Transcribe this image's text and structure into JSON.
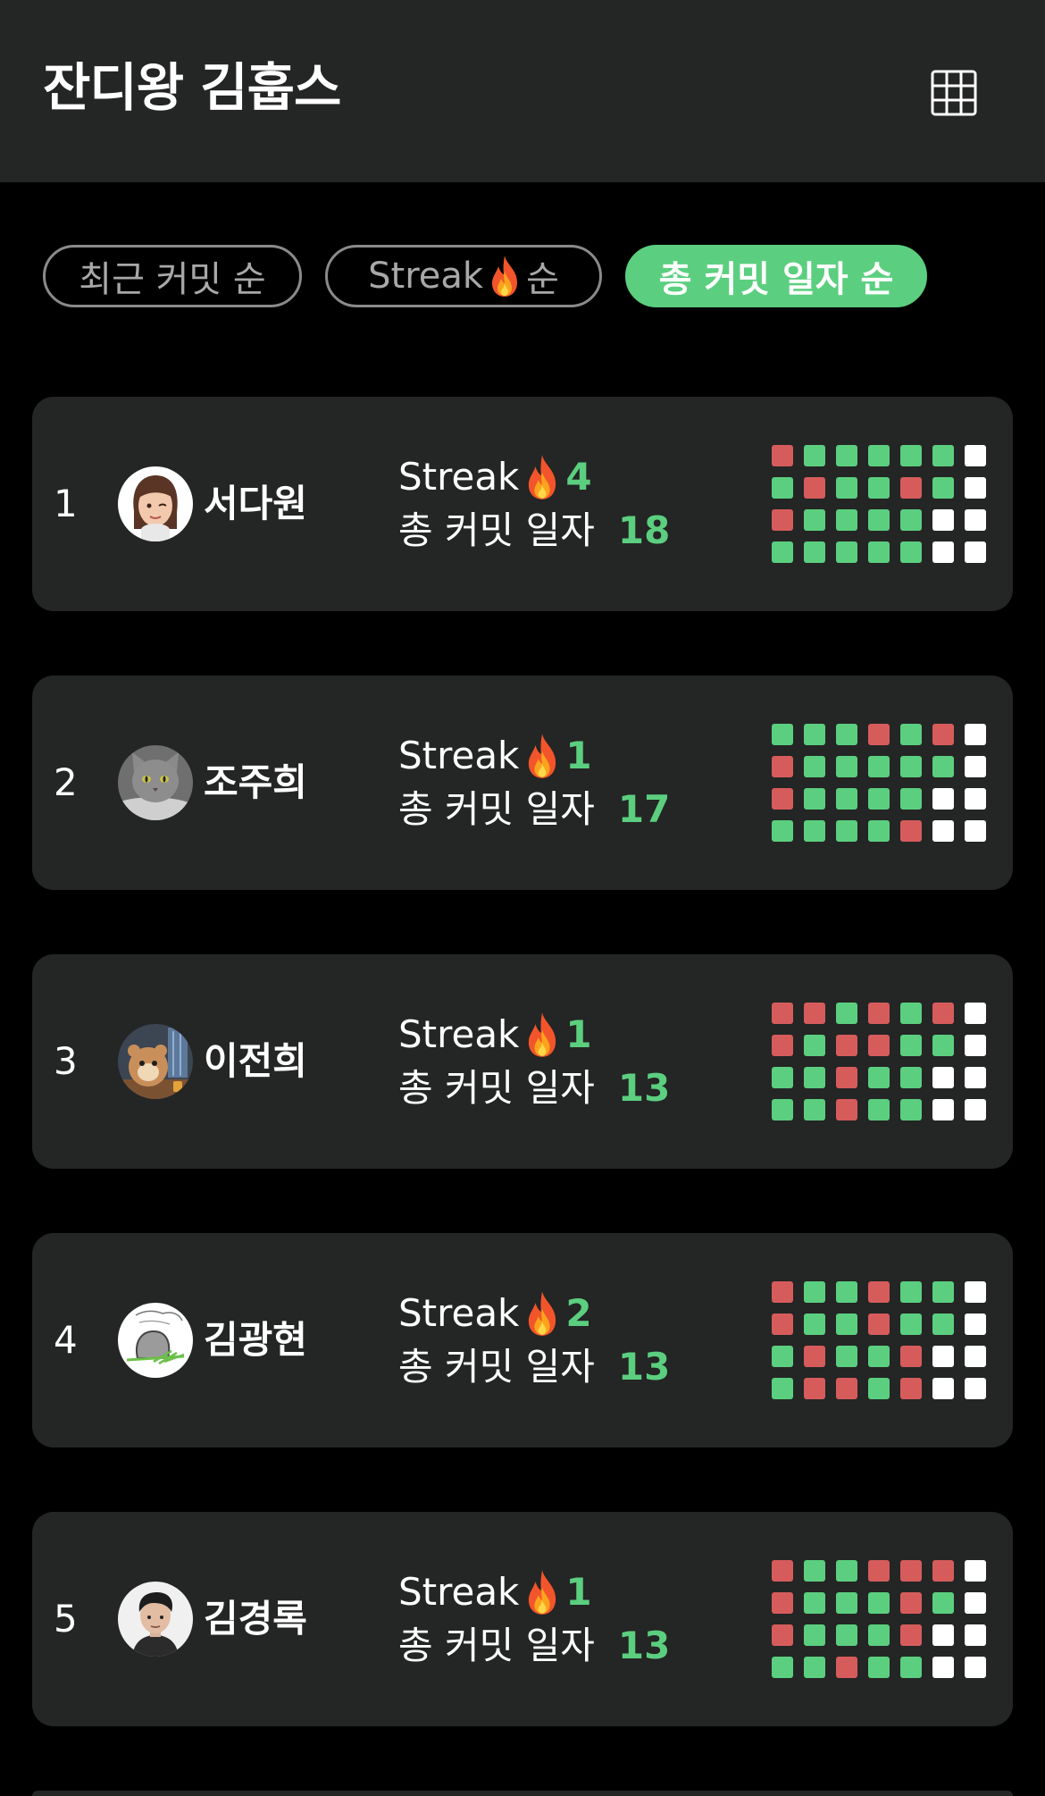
{
  "header": {
    "title": "잔디왕 김훕스",
    "grid_icon": "grid-icon"
  },
  "sort_tabs": [
    {
      "label": "최근 커밋 순",
      "active": false
    },
    {
      "label_prefix": "Streak",
      "label_suffix": "순",
      "icon": "fire-icon",
      "active": false
    },
    {
      "label": "총 커밋 일자 순",
      "active": true
    }
  ],
  "labels": {
    "streak": "Streak",
    "total": "총 커밋 일자"
  },
  "colors": {
    "green": "#5bcf7f",
    "red": "#d65c5c",
    "white": "#ffffff",
    "card": "#242525",
    "background": "#000000"
  },
  "users": [
    {
      "rank": "1",
      "name": "서다원",
      "avatar": "memoji-avatar",
      "streak": "4",
      "total": "18",
      "grid": [
        "RGGGGGW",
        "GRGGRGW",
        "RGGGGWW",
        "GGGGGWW"
      ]
    },
    {
      "rank": "2",
      "name": "조주희",
      "avatar": "cat-avatar",
      "streak": "1",
      "total": "17",
      "grid": [
        "GGGRGRW",
        "RGGGGGW",
        "RGGGGWW",
        "GGGGRWW"
      ]
    },
    {
      "rank": "3",
      "name": "이전희",
      "avatar": "hamster-avatar",
      "streak": "1",
      "total": "13",
      "grid": [
        "RRGRGRW",
        "RGRRGGW",
        "GGRGGWW",
        "GGRGGWW"
      ]
    },
    {
      "rank": "4",
      "name": "김광현",
      "avatar": "sketch-avatar",
      "streak": "2",
      "total": "13",
      "grid": [
        "RGGRGGW",
        "RGGRGGW",
        "GRGGRWW",
        "GRRGRWW"
      ]
    },
    {
      "rank": "5",
      "name": "김경록",
      "avatar": "person-avatar",
      "streak": "1",
      "total": "13",
      "grid": [
        "RGGRRRW",
        "RGGGRGW",
        "RGGGRWW",
        "GGRGGWW"
      ]
    }
  ]
}
